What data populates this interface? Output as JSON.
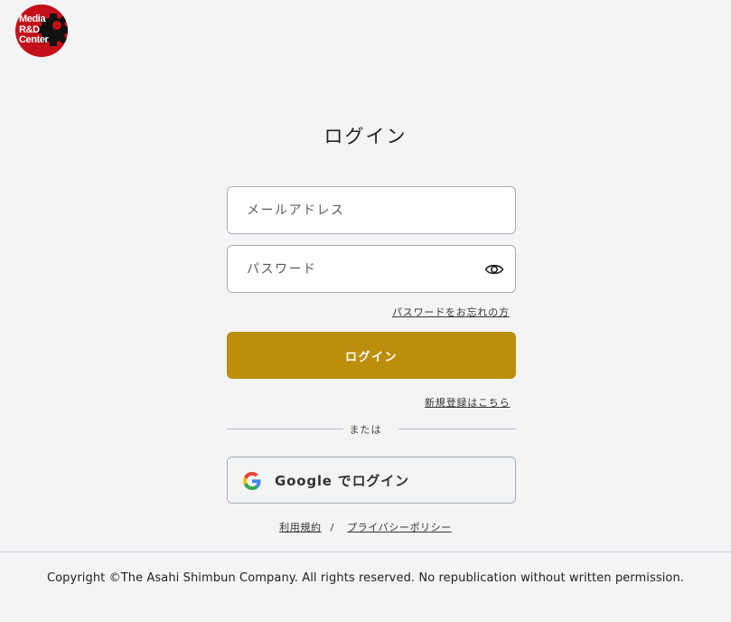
{
  "logo": {
    "lines": [
      "Media",
      "R&D",
      "Center"
    ],
    "color": "#c4101a"
  },
  "login_form": {
    "title": "ログイン",
    "email": {
      "placeholder": "メールアドレス",
      "value": ""
    },
    "password": {
      "placeholder": "パスワード",
      "value": "",
      "toggle_icon": "eye-icon"
    },
    "forgot_password_link": "パスワードをお忘れの方",
    "submit_label": "ログイン",
    "register_link": "新規登録はこちら",
    "divider_text": "または",
    "google_button_label": "Google でログイン",
    "google_icon": "google-g-icon"
  },
  "legal": {
    "terms_link": "利用規約",
    "separator": "/",
    "privacy_link": "プライバシーポリシー"
  },
  "footer": {
    "copyright": "Copyright ©The Asahi Shimbun Company. All rights reserved. No republication without written permission."
  },
  "colors": {
    "background": "#f3f4f6",
    "primary_button": "#bb8f0c",
    "logo_red": "#c4101a"
  }
}
